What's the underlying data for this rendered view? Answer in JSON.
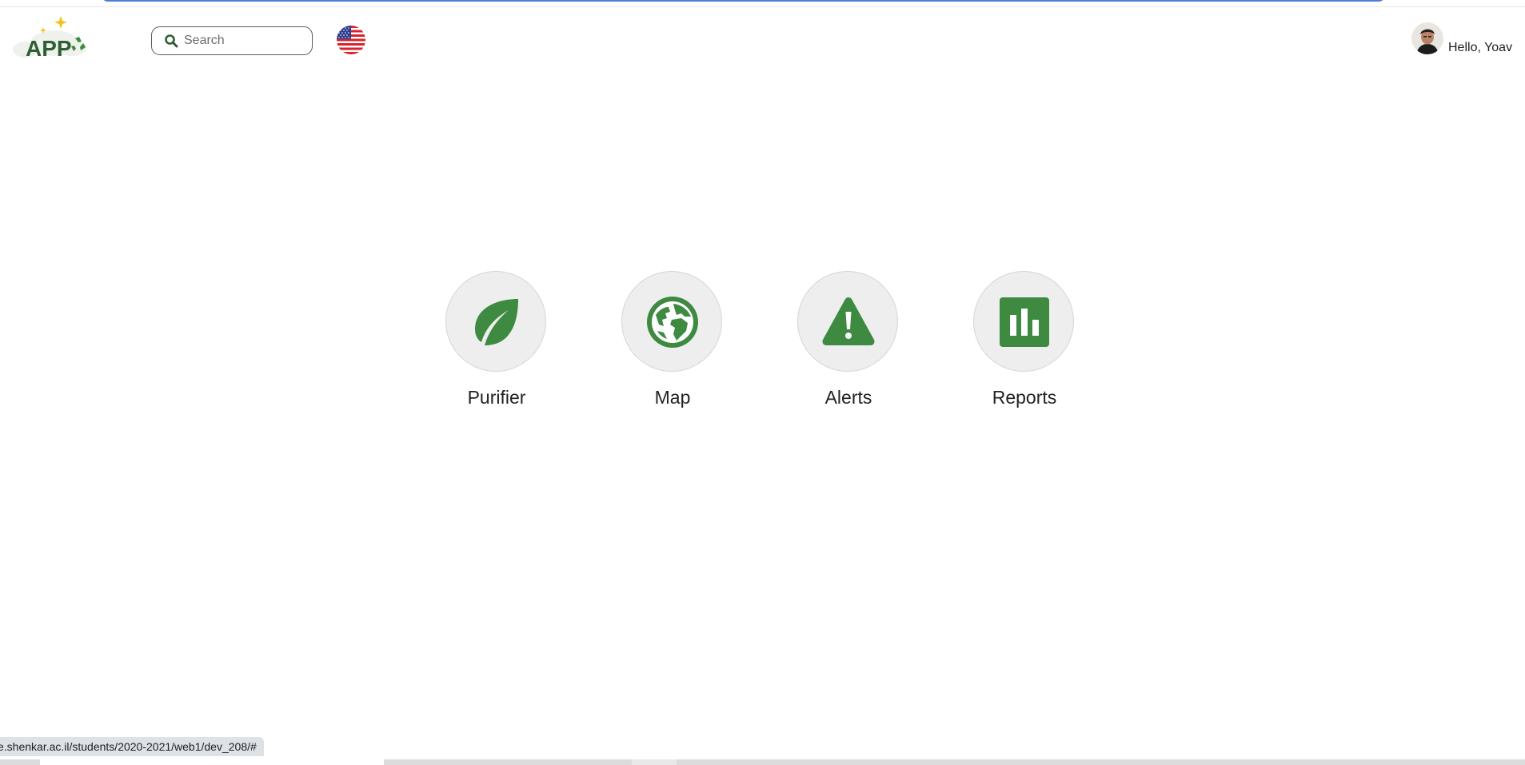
{
  "header": {
    "logo_text": "APP",
    "search": {
      "placeholder": "Search",
      "value": ""
    },
    "language_icon": "us-flag-icon",
    "user": {
      "greeting": "Hello, Yoav",
      "avatar_icon": "user-avatar"
    }
  },
  "main": {
    "tiles": [
      {
        "label": "Purifier",
        "icon": "leaf-icon"
      },
      {
        "label": "Map",
        "icon": "globe-icon"
      },
      {
        "label": "Alerts",
        "icon": "warning-icon"
      },
      {
        "label": "Reports",
        "icon": "bar-chart-icon"
      }
    ]
  },
  "status_bar": {
    "url": "e.shenkar.ac.il/students/2020-2021/web1/dev_208/#"
  },
  "colors": {
    "accent_green": "#3d8a40",
    "logo_green": "#2f5e34",
    "tile_background": "#eeeeee"
  }
}
